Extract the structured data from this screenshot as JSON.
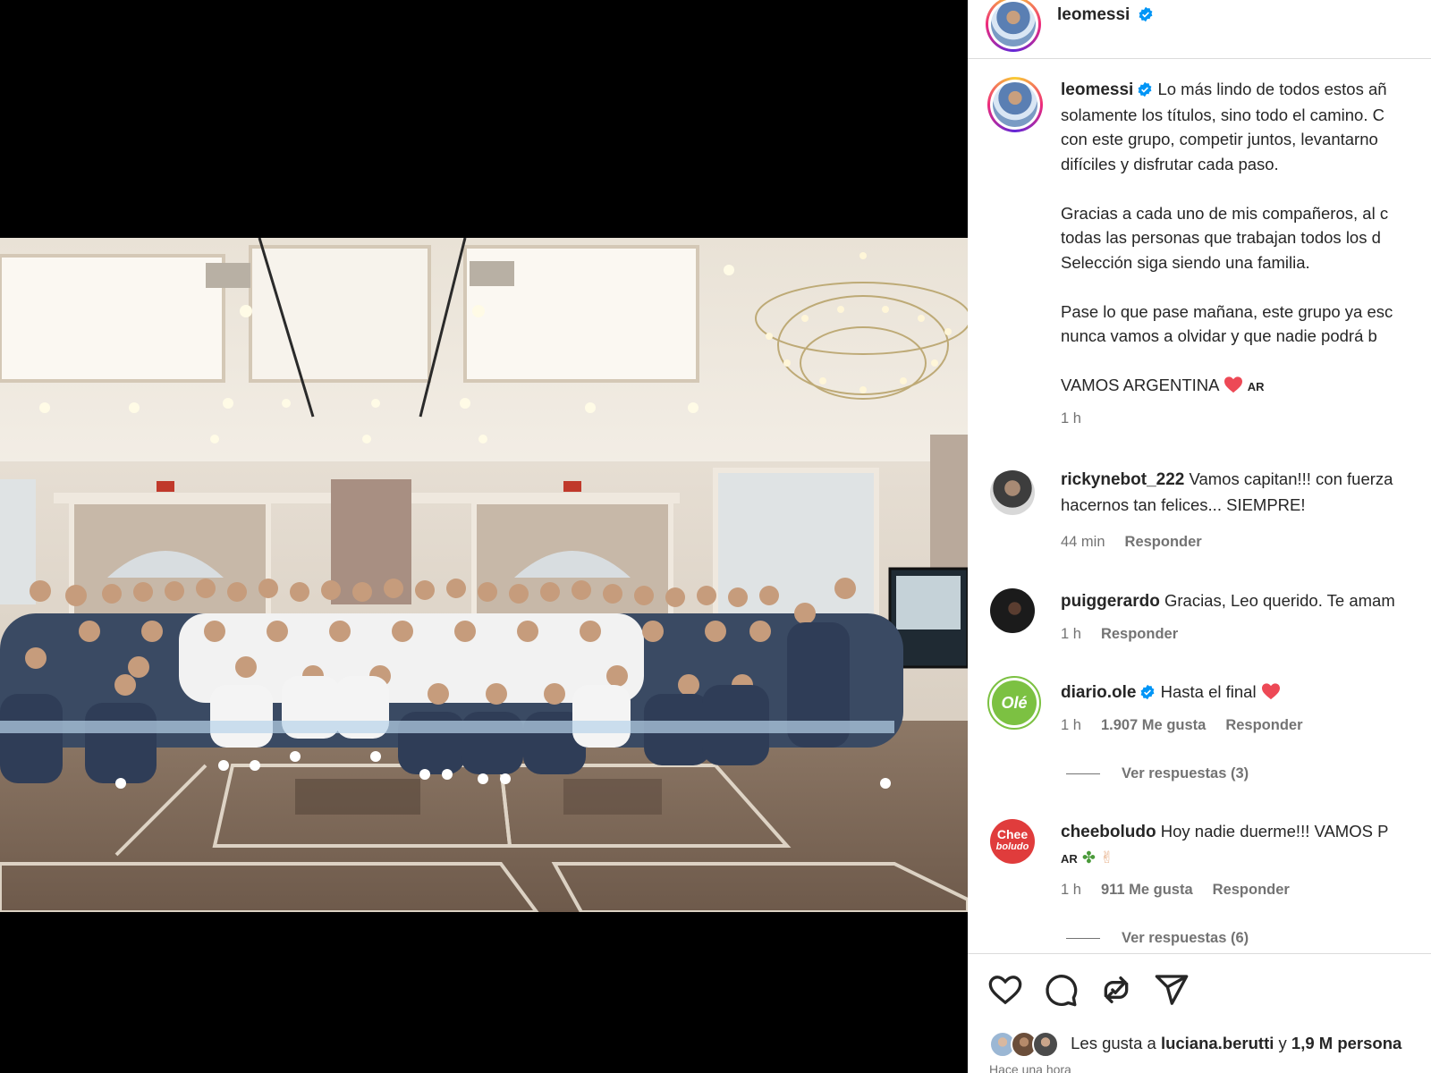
{
  "post": {
    "username": "leomessi",
    "verified": true
  },
  "caption": {
    "username": "leomessi",
    "lines": [
      "Lo más lindo de todos estos añ",
      "solamente los títulos, sino todo el camino. C",
      "con este grupo, competir juntos, levantarno",
      "difíciles y disfrutar cada paso.",
      "",
      "Gracias a cada uno de mis compañeros, al c",
      "todas las personas que trabajan todos los d",
      "Selección siga siendo una familia.",
      "",
      "Pase lo que pase mañana, este grupo ya esc",
      "nunca vamos a olvidar y que nadie podrá b",
      "",
      "VAMOS ARGENTINA"
    ],
    "flag_code": "AR",
    "time": "1 h"
  },
  "comments": [
    {
      "username": "rickynebot_222",
      "text_line1": "Vamos capitan!!! con fuerza",
      "text_line2": "hacernos tan felices... SIEMPRE!",
      "time": "44 min",
      "reply": "Responder"
    },
    {
      "username": "puiggerardo",
      "text_line1": "Gracias, Leo querido. Te amam",
      "time": "1 h",
      "reply": "Responder"
    },
    {
      "username": "diario.ole",
      "verified": true,
      "text_line1": "Hasta el final",
      "avatar_text": "Olé",
      "time": "1 h",
      "likes": "1.907 Me gusta",
      "reply": "Responder",
      "view_replies": "Ver respuestas (3)"
    },
    {
      "username": "cheeboludo",
      "text_line1": "Hoy nadie duerme!!! VAMOS P",
      "flag_code": "AR",
      "avatar_text_1": "Chee",
      "avatar_text_2": "boludo",
      "time": "1 h",
      "likes": "911 Me gusta",
      "reply": "Responder",
      "view_replies": "Ver respuestas (6)"
    }
  ],
  "likes_line": {
    "prefix": "Les gusta a",
    "user": "luciana.berutti",
    "mid": "y",
    "count": "1,9 M persona"
  },
  "time_ago": "Hace una hora",
  "icons": [
    "heart-icon",
    "comment-icon",
    "share-icon",
    "send-icon"
  ],
  "colors": {
    "verified": "#0095f6",
    "heart": "#ed4956",
    "ole_green": "#7cc142",
    "chee_red": "#e03c3c"
  }
}
